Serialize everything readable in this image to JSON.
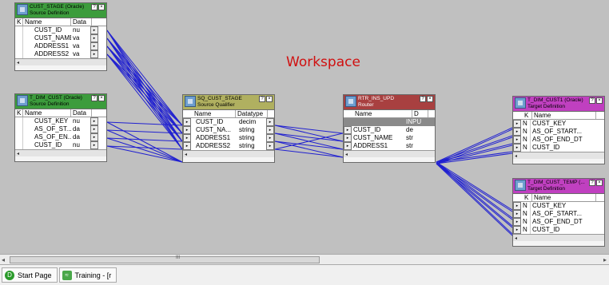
{
  "workspace_label": "Workspace",
  "colors": {
    "source_title": "#3c9c3c",
    "qualifier_title": "#b0b060",
    "router_title": "#a84040",
    "target_title": "#c040c0",
    "link_line": "#2020d0"
  },
  "transformations": [
    {
      "id": "cust_stage",
      "title": "CUST_STAGE (Oracle)",
      "subtitle": "Source Definition",
      "icon": "source-definition-icon",
      "columns": [
        "K",
        "Name",
        "Data"
      ],
      "rows": [
        [
          "",
          "CUST_ID",
          "nu"
        ],
        [
          "",
          "CUST_NAME",
          "va"
        ],
        [
          "",
          "ADDRESS1",
          "va"
        ],
        [
          "",
          "ADDRESS2",
          "va"
        ]
      ]
    },
    {
      "id": "dim_cust",
      "title": "T_DIM_CUST (Oracle)",
      "subtitle": "Source Definition",
      "icon": "source-definition-icon",
      "columns": [
        "K",
        "Name",
        "Data"
      ],
      "rows": [
        [
          "",
          "CUST_KEY",
          "nu"
        ],
        [
          "",
          "AS_OF_ST...",
          "da"
        ],
        [
          "",
          "AS_OF_EN...",
          "da"
        ],
        [
          "",
          "CUST_ID",
          "nu"
        ]
      ]
    },
    {
      "id": "sq_cust_stage",
      "title": "SQ_CUST_STAGE",
      "subtitle": "Source Qualifier",
      "icon": "source-qualifier-icon",
      "columns": [
        "Name",
        "Datatype"
      ],
      "rows": [
        [
          "CUST_ID",
          "decim"
        ],
        [
          "CUST_NA...",
          "string"
        ],
        [
          "ADDRESS1",
          "string"
        ],
        [
          "ADDRESS2",
          "string"
        ]
      ]
    },
    {
      "id": "router",
      "title": "RTR_INS_UPD",
      "subtitle": "Router",
      "icon": "router-icon",
      "columns": [
        "Name",
        "D"
      ],
      "rows": [
        [
          "",
          "INPU"
        ],
        [
          "CUST_ID",
          "de"
        ],
        [
          "CUST_NAME",
          "str"
        ],
        [
          "ADDRESS1",
          "str"
        ]
      ]
    },
    {
      "id": "target1",
      "title": "T_DIM_CUST1 (Oracle)",
      "subtitle": "Target Definition",
      "icon": "target-definition-icon",
      "columns": [
        "K",
        "Name"
      ],
      "rows": [
        [
          "N",
          "CUST_KEY"
        ],
        [
          "N",
          "AS_OF_START..."
        ],
        [
          "N",
          "AS_OF_END_DT"
        ],
        [
          "N",
          "CUST_ID"
        ]
      ]
    },
    {
      "id": "target_temp",
      "title": "T_DIM_CUST_TEMP (...",
      "subtitle": "Target Definition",
      "icon": "target-definition-icon",
      "columns": [
        "K",
        "Name"
      ],
      "rows": [
        [
          "N",
          "CUST_KEY"
        ],
        [
          "N",
          "AS_OF_START..."
        ],
        [
          "N",
          "AS_OF_END_DT"
        ],
        [
          "N",
          "CUST_ID"
        ]
      ]
    }
  ],
  "horizontal_scroll_grip": "III",
  "tabs": [
    {
      "label": "Start Page",
      "icon": "start-page-icon"
    },
    {
      "label": "Training - [r",
      "icon": "mapping-icon"
    }
  ]
}
